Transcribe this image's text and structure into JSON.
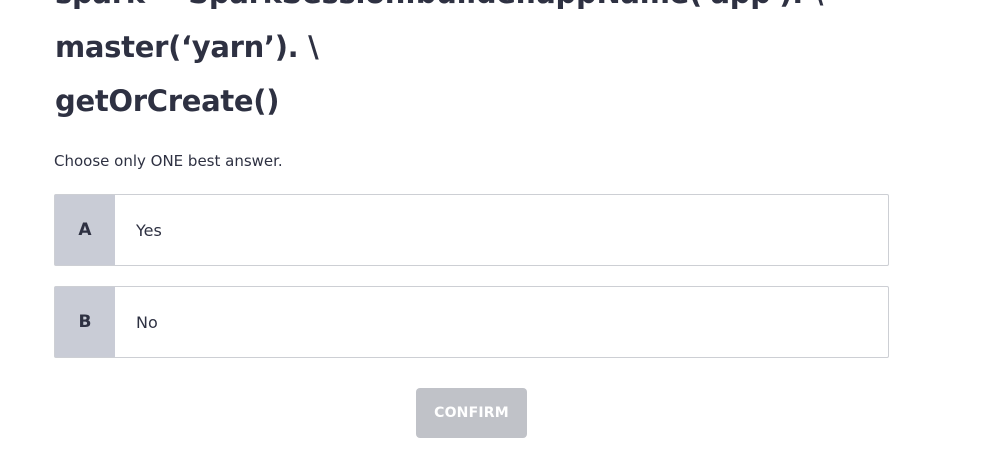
{
  "question": {
    "lines": [
      "spark = SparkSession.builder.appName('app'). \\",
      "master(‘yarn’). \\",
      "getOrCreate()"
    ]
  },
  "instruction": "Choose only ONE best answer.",
  "options": [
    {
      "letter": "A",
      "text": "Yes"
    },
    {
      "letter": "B",
      "text": "No"
    }
  ],
  "confirm_label": "CONFIRM",
  "colors": {
    "text": "#2e3142",
    "letter_bg": "#c9ccd6",
    "border": "#cdcfd4",
    "button_disabled": "#c0c2c8"
  }
}
